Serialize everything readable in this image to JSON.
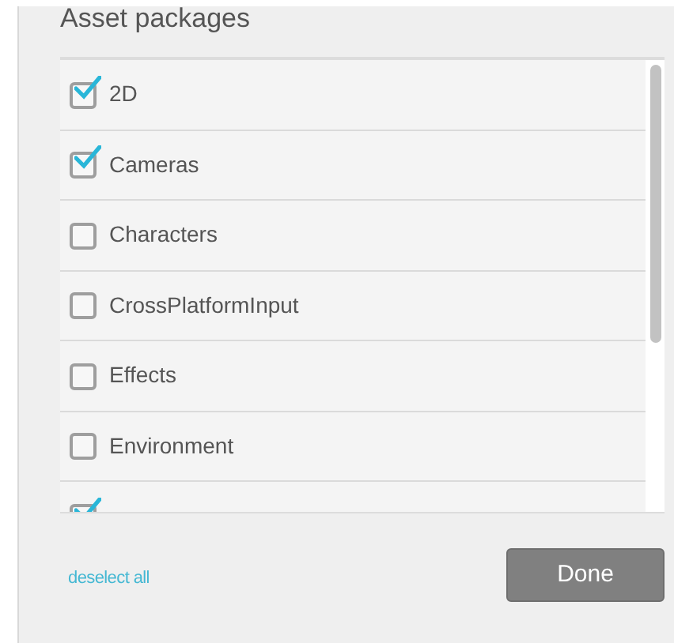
{
  "title": "Asset packages",
  "packages": [
    {
      "label": "2D",
      "checked": true
    },
    {
      "label": "Cameras",
      "checked": true
    },
    {
      "label": "Characters",
      "checked": false
    },
    {
      "label": "CrossPlatformInput",
      "checked": false
    },
    {
      "label": "Effects",
      "checked": false
    },
    {
      "label": "Environment",
      "checked": false
    },
    {
      "checked": true
    }
  ],
  "deselect_link": "deselect all",
  "done_button": "Done"
}
